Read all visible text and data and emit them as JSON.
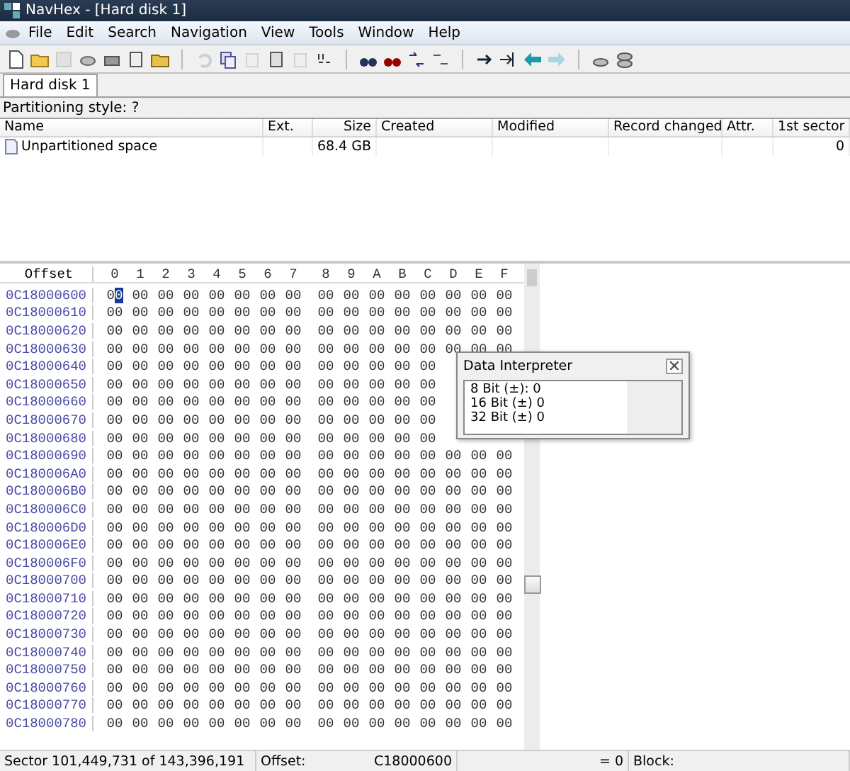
{
  "window": {
    "title": "NavHex - [Hard disk 1]"
  },
  "menu": [
    "File",
    "Edit",
    "Search",
    "Navigation",
    "View",
    "Tools",
    "Window",
    "Help"
  ],
  "tabs": [
    {
      "label": "Hard disk 1",
      "selected": true
    }
  ],
  "partitioning_label": "Partitioning style: ?",
  "table": {
    "columns": [
      "Name",
      "Ext.",
      "Size",
      "Created",
      "Modified",
      "Record changed",
      "Attr.",
      "1st sector"
    ],
    "rows": [
      {
        "cells": [
          "Unpartitioned space",
          "",
          "68.4 GB",
          "",
          "",
          "",
          "",
          "0"
        ]
      }
    ]
  },
  "hex_view": {
    "columns": [
      "Offset",
      "0",
      "1",
      "2",
      "3",
      "4",
      "5",
      "6",
      "7",
      "8",
      "9",
      "A",
      "B",
      "C",
      "D",
      "E",
      "F"
    ],
    "rows": [
      {
        "offset": "0C18000600",
        "cursor": true,
        "bytes": [
          "00",
          "00",
          "00",
          "00",
          "00",
          "00",
          "00",
          "00",
          "00",
          "00",
          "00",
          "00",
          "00",
          "00",
          "00",
          "00"
        ]
      },
      {
        "offset": "0C18000610",
        "cursor": false,
        "bytes": [
          "00",
          "00",
          "00",
          "00",
          "00",
          "00",
          "00",
          "00",
          "00",
          "00",
          "00",
          "00",
          "00",
          "00",
          "00",
          "00"
        ]
      },
      {
        "offset": "0C18000620",
        "cursor": false,
        "bytes": [
          "00",
          "00",
          "00",
          "00",
          "00",
          "00",
          "00",
          "00",
          "00",
          "00",
          "00",
          "00",
          "00",
          "00",
          "00",
          "00"
        ]
      },
      {
        "offset": "0C18000630",
        "cursor": false,
        "bytes": [
          "00",
          "00",
          "00",
          "00",
          "00",
          "00",
          "00",
          "00",
          "00",
          "00",
          "00",
          "00",
          "00",
          "00",
          "00",
          "00"
        ]
      },
      {
        "offset": "0C18000640",
        "cursor": false,
        "bytes": [
          "00",
          "00",
          "00",
          "00",
          "00",
          "00",
          "00",
          "00",
          "00",
          "00",
          "00",
          "00",
          "00"
        ]
      },
      {
        "offset": "0C18000650",
        "cursor": false,
        "bytes": [
          "00",
          "00",
          "00",
          "00",
          "00",
          "00",
          "00",
          "00",
          "00",
          "00",
          "00",
          "00",
          "00"
        ]
      },
      {
        "offset": "0C18000660",
        "cursor": false,
        "bytes": [
          "00",
          "00",
          "00",
          "00",
          "00",
          "00",
          "00",
          "00",
          "00",
          "00",
          "00",
          "00",
          "00"
        ]
      },
      {
        "offset": "0C18000670",
        "cursor": false,
        "bytes": [
          "00",
          "00",
          "00",
          "00",
          "00",
          "00",
          "00",
          "00",
          "00",
          "00",
          "00",
          "00",
          "00"
        ]
      },
      {
        "offset": "0C18000680",
        "cursor": false,
        "bytes": [
          "00",
          "00",
          "00",
          "00",
          "00",
          "00",
          "00",
          "00",
          "00",
          "00",
          "00",
          "00",
          "00"
        ]
      },
      {
        "offset": "0C18000690",
        "cursor": false,
        "bytes": [
          "00",
          "00",
          "00",
          "00",
          "00",
          "00",
          "00",
          "00",
          "00",
          "00",
          "00",
          "00",
          "00",
          "00",
          "00",
          "00"
        ]
      },
      {
        "offset": "0C180006A0",
        "cursor": false,
        "bytes": [
          "00",
          "00",
          "00",
          "00",
          "00",
          "00",
          "00",
          "00",
          "00",
          "00",
          "00",
          "00",
          "00",
          "00",
          "00",
          "00"
        ]
      },
      {
        "offset": "0C180006B0",
        "cursor": false,
        "bytes": [
          "00",
          "00",
          "00",
          "00",
          "00",
          "00",
          "00",
          "00",
          "00",
          "00",
          "00",
          "00",
          "00",
          "00",
          "00",
          "00"
        ]
      },
      {
        "offset": "0C180006C0",
        "cursor": false,
        "bytes": [
          "00",
          "00",
          "00",
          "00",
          "00",
          "00",
          "00",
          "00",
          "00",
          "00",
          "00",
          "00",
          "00",
          "00",
          "00",
          "00"
        ]
      },
      {
        "offset": "0C180006D0",
        "cursor": false,
        "bytes": [
          "00",
          "00",
          "00",
          "00",
          "00",
          "00",
          "00",
          "00",
          "00",
          "00",
          "00",
          "00",
          "00",
          "00",
          "00",
          "00"
        ]
      },
      {
        "offset": "0C180006E0",
        "cursor": false,
        "bytes": [
          "00",
          "00",
          "00",
          "00",
          "00",
          "00",
          "00",
          "00",
          "00",
          "00",
          "00",
          "00",
          "00",
          "00",
          "00",
          "00"
        ]
      },
      {
        "offset": "0C180006F0",
        "cursor": false,
        "bytes": [
          "00",
          "00",
          "00",
          "00",
          "00",
          "00",
          "00",
          "00",
          "00",
          "00",
          "00",
          "00",
          "00",
          "00",
          "00",
          "00"
        ]
      },
      {
        "offset": "0C18000700",
        "cursor": false,
        "bytes": [
          "00",
          "00",
          "00",
          "00",
          "00",
          "00",
          "00",
          "00",
          "00",
          "00",
          "00",
          "00",
          "00",
          "00",
          "00",
          "00"
        ]
      },
      {
        "offset": "0C18000710",
        "cursor": false,
        "bytes": [
          "00",
          "00",
          "00",
          "00",
          "00",
          "00",
          "00",
          "00",
          "00",
          "00",
          "00",
          "00",
          "00",
          "00",
          "00",
          "00"
        ]
      },
      {
        "offset": "0C18000720",
        "cursor": false,
        "bytes": [
          "00",
          "00",
          "00",
          "00",
          "00",
          "00",
          "00",
          "00",
          "00",
          "00",
          "00",
          "00",
          "00",
          "00",
          "00",
          "00"
        ]
      },
      {
        "offset": "0C18000730",
        "cursor": false,
        "bytes": [
          "00",
          "00",
          "00",
          "00",
          "00",
          "00",
          "00",
          "00",
          "00",
          "00",
          "00",
          "00",
          "00",
          "00",
          "00",
          "00"
        ]
      },
      {
        "offset": "0C18000740",
        "cursor": false,
        "bytes": [
          "00",
          "00",
          "00",
          "00",
          "00",
          "00",
          "00",
          "00",
          "00",
          "00",
          "00",
          "00",
          "00",
          "00",
          "00",
          "00"
        ]
      },
      {
        "offset": "0C18000750",
        "cursor": false,
        "bytes": [
          "00",
          "00",
          "00",
          "00",
          "00",
          "00",
          "00",
          "00",
          "00",
          "00",
          "00",
          "00",
          "00",
          "00",
          "00",
          "00"
        ]
      },
      {
        "offset": "0C18000760",
        "cursor": false,
        "bytes": [
          "00",
          "00",
          "00",
          "00",
          "00",
          "00",
          "00",
          "00",
          "00",
          "00",
          "00",
          "00",
          "00",
          "00",
          "00",
          "00"
        ]
      },
      {
        "offset": "0C18000770",
        "cursor": false,
        "bytes": [
          "00",
          "00",
          "00",
          "00",
          "00",
          "00",
          "00",
          "00",
          "00",
          "00",
          "00",
          "00",
          "00",
          "00",
          "00",
          "00"
        ]
      },
      {
        "offset": "0C18000780",
        "cursor": false,
        "bytes": [
          "00",
          "00",
          "00",
          "00",
          "00",
          "00",
          "00",
          "00",
          "00",
          "00",
          "00",
          "00",
          "00",
          "00",
          "00",
          "00"
        ]
      }
    ]
  },
  "data_interpreter": {
    "title": "Data Interpreter",
    "lines": [
      "8 Bit (±): 0",
      "16 Bit (±) 0",
      "32 Bit (±) 0"
    ]
  },
  "status_bar": {
    "sector": "Sector 101,449,731 of 143,396,191",
    "offset_label": "Offset:",
    "offset_value": "C18000600",
    "value": "= 0",
    "block_label": "Block:"
  }
}
